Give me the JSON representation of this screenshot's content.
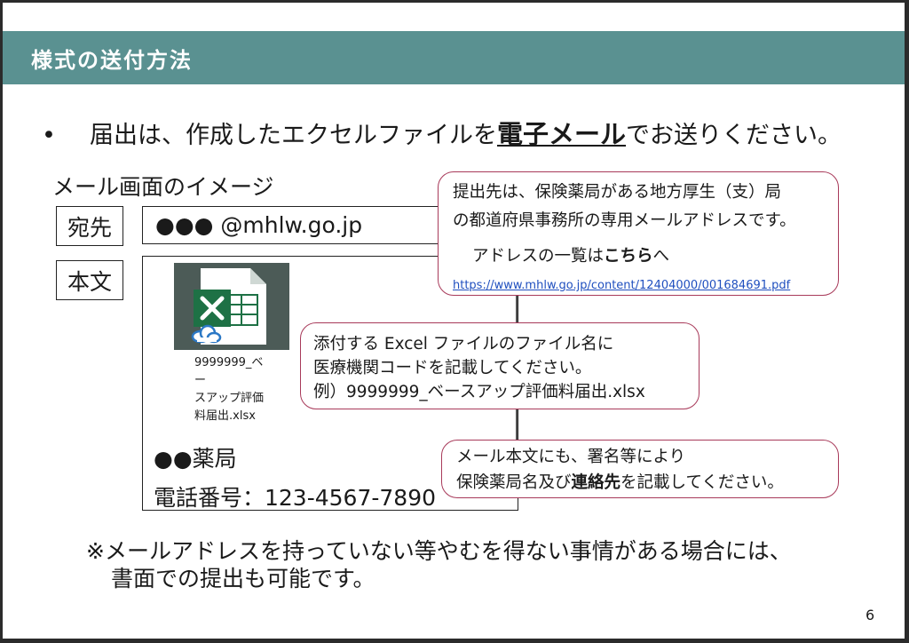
{
  "header": {
    "title": "様式の送付方法"
  },
  "bullet": {
    "marker": "•",
    "text_before": "届出は、作成したエクセルファイルを",
    "emphasis": "電子メール",
    "text_after": "でお送りください。"
  },
  "mail_mock": {
    "caption": "メール画面のイメージ",
    "to_label": "宛先",
    "to_value": "●●● @mhlw.go.jp",
    "body_label": "本文",
    "attachment": {
      "lines": [
        "9999999_ベー",
        "スアップ評価",
        "料届出.xlsx"
      ]
    },
    "pharmacy_name": "●●薬局",
    "phone": "電話番号：123-4567-7890"
  },
  "callout_address": {
    "line1": "提出先は、保険薬局がある地方厚生（支）局",
    "line2": "の都道府県事務所の専用メールアドレスです。",
    "line3_before": "アドレスの一覧は",
    "line3_bold": "こちら",
    "line3_after": "へ",
    "url": "https://www.mhlw.go.jp/content/12404000/001684691.pdf"
  },
  "callout_filename": {
    "line1": "添付する Excel ファイルのファイル名に",
    "line2": "医療機関コードを記載してください。",
    "line3": "例）9999999_ベースアップ評価料届出.xlsx"
  },
  "callout_signature": {
    "line1": "メール本文にも、署名等により",
    "line2_before": "保険薬局名及び",
    "line2_bold": "連絡先",
    "line2_after": "を記載してください。"
  },
  "note": {
    "line1": "※メールアドレスを持っていない等やむを得ない事情がある場合には、",
    "line2": "書面での提出も可能です。"
  },
  "page_number": "6",
  "colors": {
    "banner": "#5a9191",
    "callout_border": "#a83a5a",
    "link": "#1f4fbf",
    "excel_green": "#1e7145"
  }
}
